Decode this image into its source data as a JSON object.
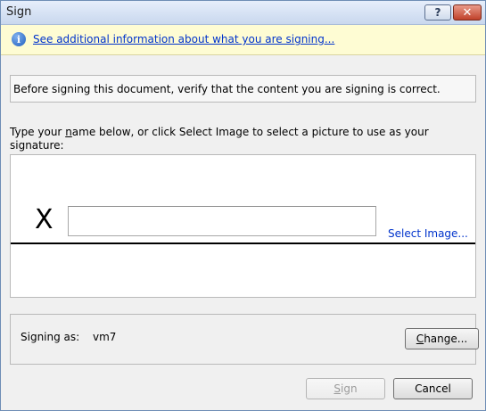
{
  "window": {
    "title": "Sign",
    "help_symbol": "?",
    "close_symbol": "✕"
  },
  "infobar": {
    "icon": "info-icon",
    "icon_glyph": "i",
    "link_text": "See additional information about what you are signing..."
  },
  "verify": {
    "text": "Before signing this document, verify that the content you are signing is correct."
  },
  "instructions": {
    "text": "Type your name below, or click Select Image to select a picture to use as your signature:"
  },
  "signature": {
    "x_mark": "X",
    "input_value": "",
    "input_placeholder": "",
    "select_image_label": "Select Image..."
  },
  "signing_as": {
    "label": "Signing as:",
    "user": "vm7",
    "change_label": "Change..."
  },
  "buttons": {
    "sign_label": "Sign",
    "cancel_label": "Cancel"
  },
  "colors": {
    "link": "#0033cc",
    "infobar_bg": "#fefcd3",
    "dialog_bg": "#f0f0f0"
  }
}
